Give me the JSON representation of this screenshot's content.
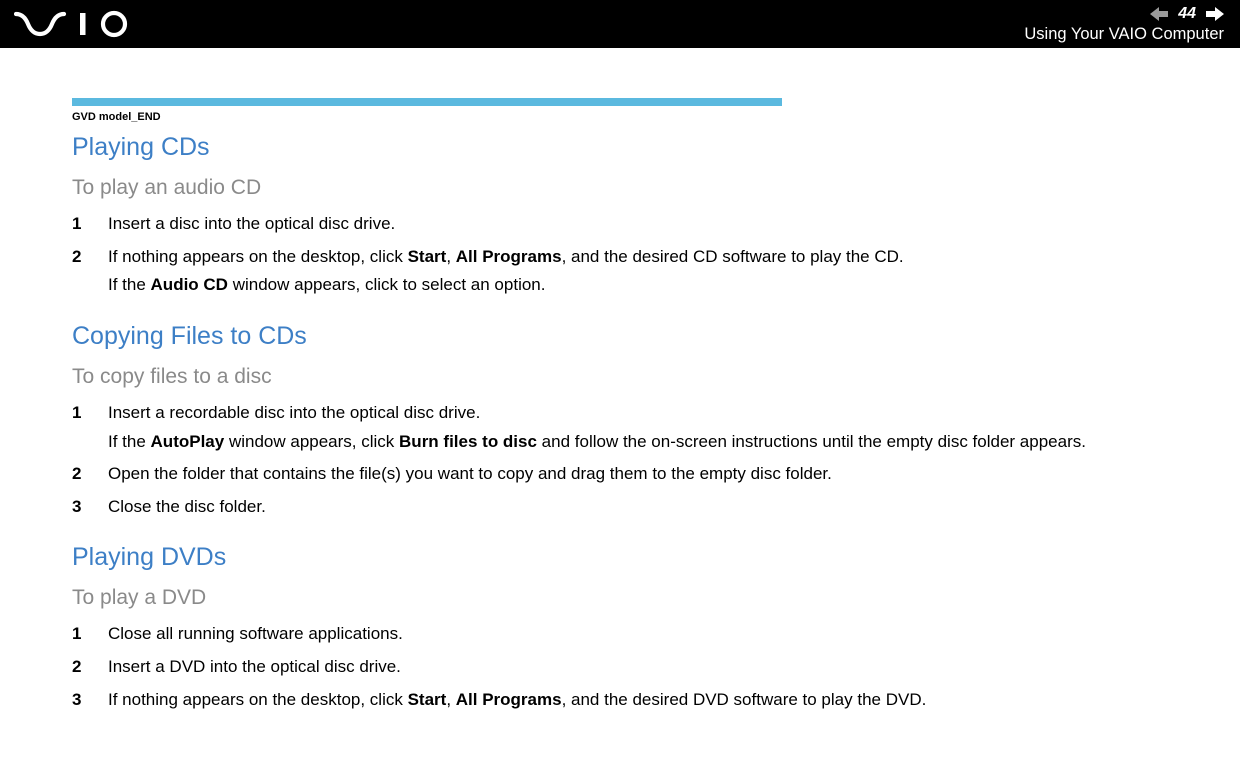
{
  "header": {
    "page_number": "44",
    "breadcrumb": "Using Your VAIO Computer"
  },
  "tag": {
    "label": "GVD model_END"
  },
  "sections": [
    {
      "heading": "Playing CDs",
      "subheading": "To play an audio CD",
      "steps": [
        {
          "num": "1",
          "text": "Insert a disc into the optical disc drive."
        },
        {
          "num": "2",
          "html": "If nothing appears on the desktop, click <b>Start</b>, <b>All Programs</b>, and the desired CD software to play the CD.",
          "sub_html": "If the <b>Audio CD</b> window appears, click to select an option."
        }
      ]
    },
    {
      "heading": "Copying Files to CDs",
      "subheading": "To copy files to a disc",
      "steps": [
        {
          "num": "1",
          "text": "Insert a recordable disc into the optical disc drive.",
          "sub_html": "If the <b>AutoPlay</b> window appears, click <b>Burn files to disc</b> and follow the on-screen instructions until the empty disc folder appears."
        },
        {
          "num": "2",
          "text": "Open the folder that contains the file(s) you want to copy and drag them to the empty disc folder."
        },
        {
          "num": "3",
          "text": "Close the disc folder."
        }
      ]
    },
    {
      "heading": "Playing DVDs",
      "subheading": "To play a DVD",
      "steps": [
        {
          "num": "1",
          "text": "Close all running software applications."
        },
        {
          "num": "2",
          "text": "Insert a DVD into the optical disc drive."
        },
        {
          "num": "3",
          "html": "If nothing appears on the desktop, click <b>Start</b>, <b>All Programs</b>, and the desired DVD software to play the DVD."
        }
      ]
    }
  ]
}
